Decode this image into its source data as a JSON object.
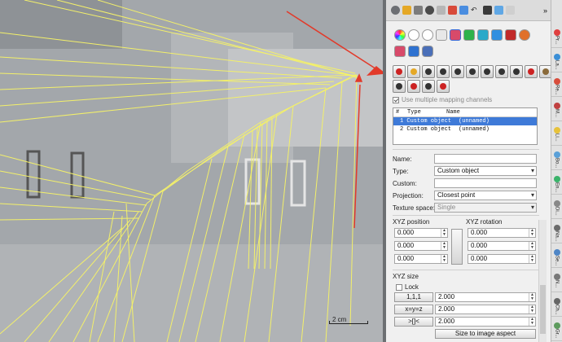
{
  "viewport": {
    "scale_label": "2 cm"
  },
  "toolbar": {
    "more": "»"
  },
  "mapping": {
    "use_multiple_label": "Use multiple mapping channels",
    "use_multiple_checked": true
  },
  "table": {
    "headers": [
      "#",
      "Type",
      "Name"
    ],
    "rows": [
      {
        "type": "1 Custom object",
        "name": "(unnamed)",
        "selected": true
      },
      {
        "type": "2 Custom object",
        "name": "(unnamed)",
        "selected": false
      }
    ]
  },
  "form": {
    "name_label": "Name:",
    "name_value": "",
    "type_label": "Type:",
    "type_value": "Custom object",
    "custom_label": "Custom:",
    "custom_value": "",
    "projection_label": "Projection:",
    "projection_value": "Closest point",
    "texture_label": "Texture space:",
    "texture_value": "Single"
  },
  "xyz_position": {
    "label": "XYZ position",
    "x": "0.000",
    "y": "0.000",
    "z": "0.000"
  },
  "xyz_rotation": {
    "label": "XYZ rotation",
    "x": "0.000",
    "y": "0.000",
    "z": "0.000"
  },
  "xyz_size": {
    "label": "XYZ size",
    "lock_label": "Lock",
    "btn1": "1,1,1",
    "btn2": "x=y=z",
    "btn3": ">[]<",
    "v1": "2.000",
    "v2": "2.000",
    "v3": "2.000",
    "aspect_button": "Size to image aspect"
  },
  "right_tabs": [
    {
      "label": "Pr...",
      "color": "#e04040"
    },
    {
      "label": "La...",
      "color": "#3a8ed6"
    },
    {
      "label": "Re...",
      "color": "#d84d3c"
    },
    {
      "label": "M...",
      "color": "#c04040"
    },
    {
      "label": "Li...",
      "color": "#e7c23a"
    },
    {
      "label": "Bo...",
      "color": "#5aa0d8"
    },
    {
      "label": "En...",
      "color": "#3ab36a"
    },
    {
      "label": "Di...",
      "color": "#888888"
    },
    {
      "label": "Na...",
      "color": "#6a6a6a"
    },
    {
      "label": "Se...",
      "color": "#4f86c6"
    },
    {
      "label": "N...",
      "color": "#777777"
    },
    {
      "label": "Ch...",
      "color": "#666666"
    },
    {
      "label": "Gr...",
      "color": "#5d9b5d"
    }
  ]
}
